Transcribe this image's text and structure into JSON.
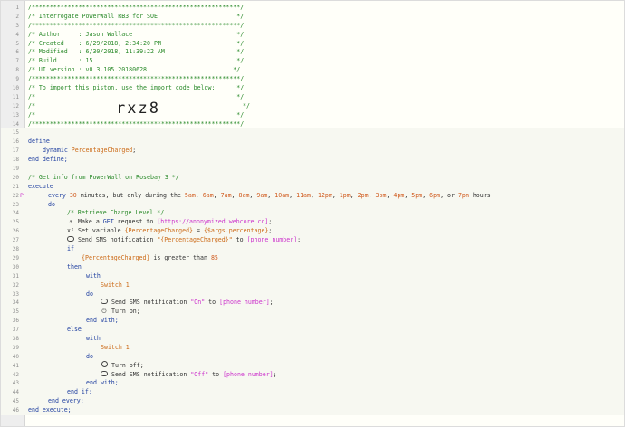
{
  "editor": {
    "line_numbers": [
      "1",
      "2",
      "3",
      "4",
      "5",
      "6",
      "7",
      "8",
      "9",
      "10",
      "11",
      "12",
      "13",
      "14",
      "15",
      "16",
      "17",
      "18",
      "19",
      "20",
      "21",
      "22",
      "23",
      "24",
      "25",
      "26",
      "27",
      "28",
      "29",
      "30",
      "31",
      "32",
      "33",
      "34",
      "35",
      "36",
      "37",
      "38",
      "39",
      "40",
      "41",
      "42",
      "43",
      "44",
      "45",
      "46"
    ],
    "marker_22": "P"
  },
  "header": {
    "border": "/**********************************************************/",
    "title": "/* Interrogate PowerWall RB3 for SOE                      */",
    "author": "/* Author     : Jason Wallace                             */",
    "created": "/* Created    : 6/29/2018, 2:34:20 PM                     */",
    "modified": "/* Modified   : 6/30/2018, 11:39:22 AM                    */",
    "build": "/* Build      : 15                                        */",
    "ui_version": "/* UI version : v0.3.105.20180628                        */",
    "import_note": "/* To import this piston, use the import code below:      */",
    "blank_open": "/*                                                        */",
    "code_prefix": "/*",
    "import_code": "rxz8",
    "code_suffix": "*/"
  },
  "define_block": {
    "define_kw": "define",
    "dynamic_kw": "dynamic",
    "var_name": "PercentageCharged",
    "semicolon": ";",
    "end_define": "end define;"
  },
  "execute_block": {
    "comment": "/* Get info from PowerWall on Rosebay 3 */",
    "execute_kw": "execute",
    "every_prefix": "every ",
    "interval": "30",
    "every_suffix": " minutes, but only during the ",
    "hours": [
      "5am",
      "6am",
      "7am",
      "8am",
      "9am",
      "10am",
      "11am",
      "12pm",
      "1pm",
      "2pm",
      "3pm",
      "4pm",
      "5pm",
      "6pm"
    ],
    "hours_last_joiner": ", or ",
    "hours_last": "7pm",
    "hours_suffix": " hours",
    "do_kw": "do",
    "retrieve_comment": "/* Retrieve Charge Level */",
    "make_text": " Make a ",
    "get_kw": "GET",
    "request_to": " request to ",
    "url": "[https://anonymized.webcore.co]",
    "end_semicolon": ";",
    "set_text": " Set variable ",
    "set_var": "{PercentageCharged}",
    "set_eq": " = ",
    "set_value": "{$args.percentage}",
    "sms_text": " Send SMS notification ",
    "sms_msg_pc": "\"{PercentageCharged}\"",
    "sms_to": " to ",
    "phone": "[phone number]",
    "if_kw": "if",
    "cond_var": "{PercentageCharged}",
    "cond_op": " is greater than ",
    "cond_val": "85",
    "then_kw": "then",
    "with_kw": "with",
    "device": "Switch 1",
    "sms_msg_on": "\"On\"",
    "turn_on": " Turn on;",
    "end_with": "end with;",
    "else_kw": "else",
    "turn_off": " Turn off;",
    "sms_msg_off": "\"Off\"",
    "end_if": "end if;",
    "end_every": "end every;",
    "end_execute": "end execute;"
  },
  "colors": {
    "comment": "#2a8a2a",
    "keyword": "#1f3fa0",
    "variable": "#cc6a17",
    "literal": "#cc33cc",
    "guide": "#a9c6ea",
    "guide_selected": "#2a7de1"
  },
  "icons": {
    "anchor": "anchor-icon",
    "variable": "superscript-x-icon",
    "sms": "chat-bubble-icon",
    "power": "power-icon",
    "off": "circle-off-icon"
  }
}
